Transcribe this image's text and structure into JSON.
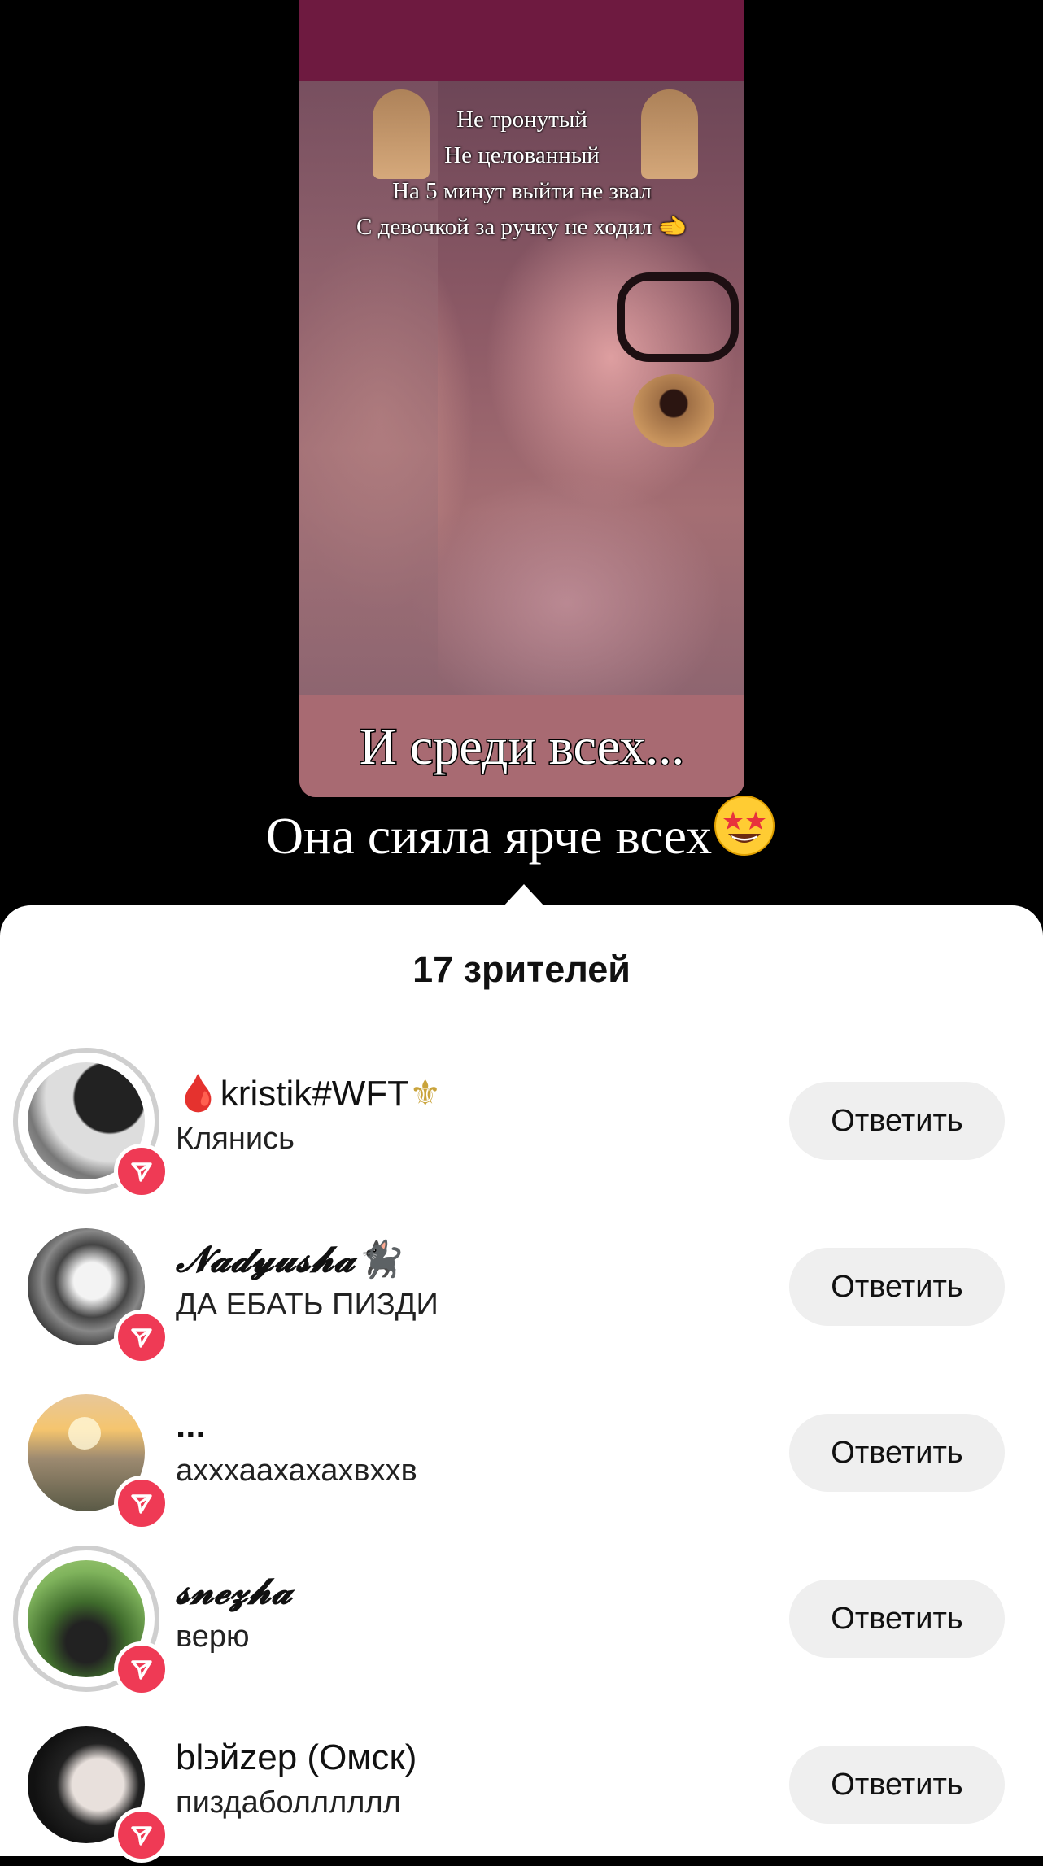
{
  "story": {
    "lyrics": [
      "Не тронутый",
      "Не целованный",
      "На 5 минут выйти не звал",
      "С девочкой за ручку не ходил 🫲"
    ],
    "caption_1": "И среди всех...",
    "caption_2": "Она сияла ярче всех",
    "caption_2_emoji": "star-struck-emoji"
  },
  "viewers": {
    "title": "17 зрителей",
    "reply_label": "Ответить",
    "items": [
      {
        "prefix": "🩸",
        "name": "kristik#WFT",
        "suffix": "⚜",
        "comment": "Клянись",
        "has_ring": true
      },
      {
        "prefix": "",
        "name": "𝓝𝓪𝓭𝔂𝓾𝓼𝓱𝓪",
        "suffix": "🐈‍⬛",
        "comment": "ДА ЕБАТЬ ПИЗДИ",
        "has_ring": false
      },
      {
        "prefix": "",
        "name": "...",
        "suffix": "",
        "comment": "ахххаахахахвхxв",
        "has_ring": false
      },
      {
        "prefix": "",
        "name": "𝓼𝓷𝓮𝔃𝓱𝓪",
        "suffix": "",
        "comment": "верю",
        "has_ring": true
      },
      {
        "prefix": "",
        "name": "bl϶йzep (Омск)",
        "suffix": "",
        "comment": "пиздаболллллл",
        "has_ring": false
      }
    ]
  },
  "colors": {
    "badge": "#ef3a55",
    "button_bg": "#efefef",
    "story_band": "#6e1a40"
  }
}
